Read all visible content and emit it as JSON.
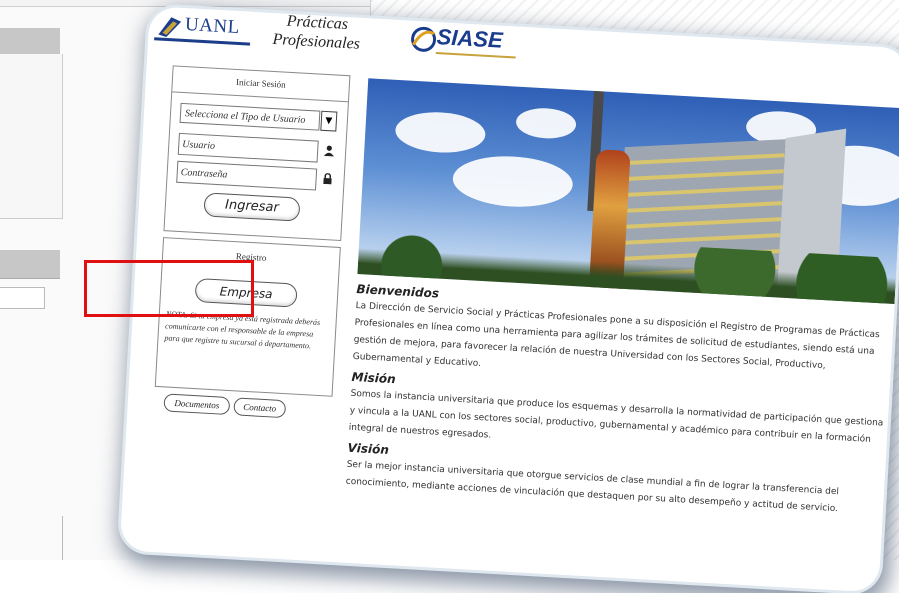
{
  "header": {
    "uanl": "UANL",
    "title_line1": "Prácticas",
    "title_line2": "Profesionales",
    "siase": "SIASE"
  },
  "login": {
    "title": "Iniciar Sesión",
    "user_type_select": "Selecciona el Tipo de Usuario",
    "username_placeholder": "Usuario",
    "password_placeholder": "Contraseña",
    "submit_label": "Ingresar"
  },
  "registro": {
    "title": "Registro",
    "empresa_label": "Empresa",
    "note": "NOTA: Si tu empresa ya está registrada deberás comunicarte con el responsable de la empresa para que registre tu sucursal ó departamento."
  },
  "links": {
    "documentos": "Documentos",
    "contacto": "Contacto"
  },
  "content": {
    "welcome_title": "Bienvenidos",
    "welcome_text": "La Dirección de Servicio Social y Prácticas Profesionales pone a su disposición el Registro de Programas de Prácticas Profesionales en línea como una herramienta para agilizar los trámites de solicitud de estudiantes, siendo está una gestión de mejora, para favorecer la relación de nuestra Universidad con los Sectores Social, Productivo, Gubernamental y Educativo.",
    "mission_title": "Misión",
    "mission_text": "Somos la instancia universitaria que produce los esquemas y desarrolla la normatividad de participación que gestiona y vincula a la UANL con los sectores social, productivo, gubernamental y académico para contribuir en la formación integral de nuestros egresados.",
    "vision_title": "Visión",
    "vision_text": "Ser la mejor instancia universitaria que otorgue servicios de clase mundial a fin de lograr la transferencia del conocimiento, mediante acciones de vinculación que destaquen por su alto desempeño y actitud de servicio."
  },
  "colors": {
    "highlight": "#e01010",
    "brand_blue": "#1c3d8a"
  }
}
